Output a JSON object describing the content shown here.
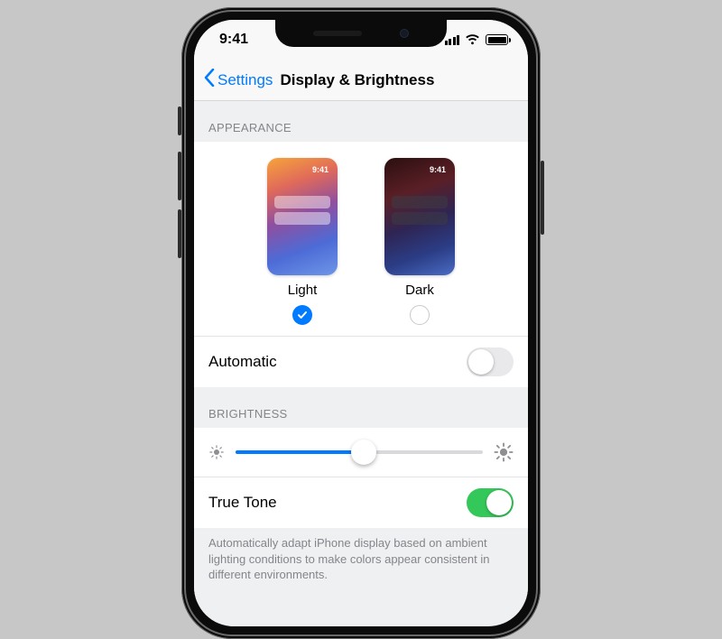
{
  "status": {
    "time": "9:41"
  },
  "nav": {
    "back_label": "Settings",
    "title": "Display & Brightness"
  },
  "appearance": {
    "section_label": "APPEARANCE",
    "preview_time": "9:41",
    "options": [
      {
        "label": "Light",
        "selected": true
      },
      {
        "label": "Dark",
        "selected": false
      }
    ],
    "automatic": {
      "label": "Automatic",
      "on": false
    }
  },
  "brightness": {
    "section_label": "BRIGHTNESS",
    "value_pct": 52,
    "true_tone": {
      "label": "True Tone",
      "on": true
    },
    "footnote": "Automatically adapt iPhone display based on ambient lighting conditions to make colors appear consistent in different environments."
  },
  "colors": {
    "accent": "#007aff",
    "green": "#34c759"
  }
}
